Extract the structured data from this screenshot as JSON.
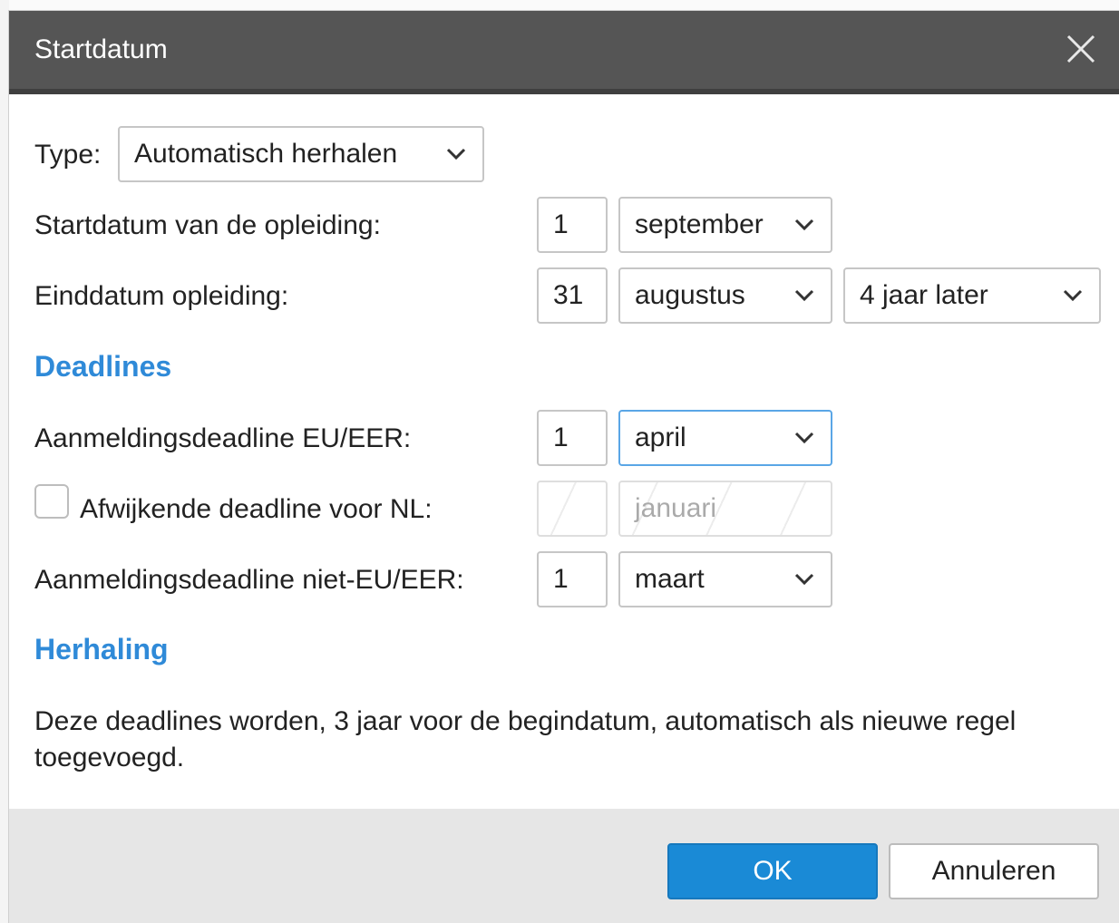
{
  "dialog": {
    "title": "Startdatum",
    "close_icon": "close-icon"
  },
  "type_row": {
    "label": "Type:",
    "value": "Automatisch herhalen"
  },
  "start_row": {
    "label": "Startdatum van de opleiding:",
    "day": "1",
    "month": "september"
  },
  "end_row": {
    "label": "Einddatum opleiding:",
    "day": "31",
    "month": "augustus",
    "year_offset": "4 jaar later"
  },
  "deadlines": {
    "heading": "Deadlines",
    "eu": {
      "label": "Aanmeldingsdeadline EU/EER:",
      "day": "1",
      "month": "april"
    },
    "nl": {
      "label": "Afwijkende deadline voor NL:",
      "checked": false,
      "day": "",
      "month_placeholder": "januari"
    },
    "non_eu": {
      "label": "Aanmeldingsdeadline niet-EU/EER:",
      "day": "1",
      "month": "maart"
    }
  },
  "herhaling": {
    "heading": "Herhaling",
    "description": "Deze deadlines worden, 3 jaar voor de begindatum, automatisch als nieuwe regel toegevoegd."
  },
  "footer": {
    "ok_label": "OK",
    "cancel_label": "Annuleren"
  },
  "colors": {
    "titlebar": "#555555",
    "accent": "#2f8ad8",
    "ok_button": "#1a8ad6"
  }
}
